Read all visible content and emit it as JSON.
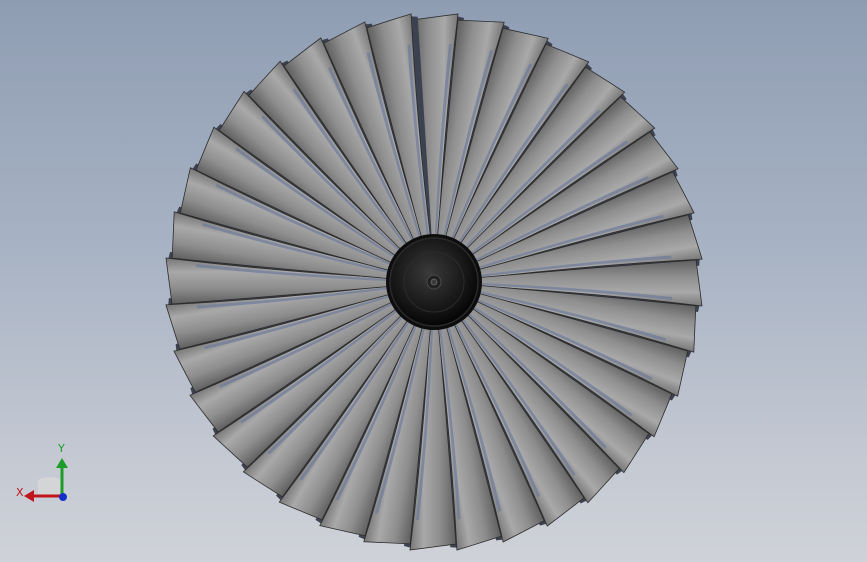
{
  "viewport": {
    "background_top": "#8f9db3",
    "background_bottom": "#cfd2d8"
  },
  "model": {
    "description_icon": "fan-rotor-icon",
    "blade_count": 36,
    "blade_color": "#8d8d8d",
    "hub_color": "#1b1b1b"
  },
  "triad": {
    "x_label": "X",
    "y_label": "Y",
    "x_color": "#c0161b",
    "y_color": "#1e9c2a",
    "z_color": "#1530c8"
  }
}
